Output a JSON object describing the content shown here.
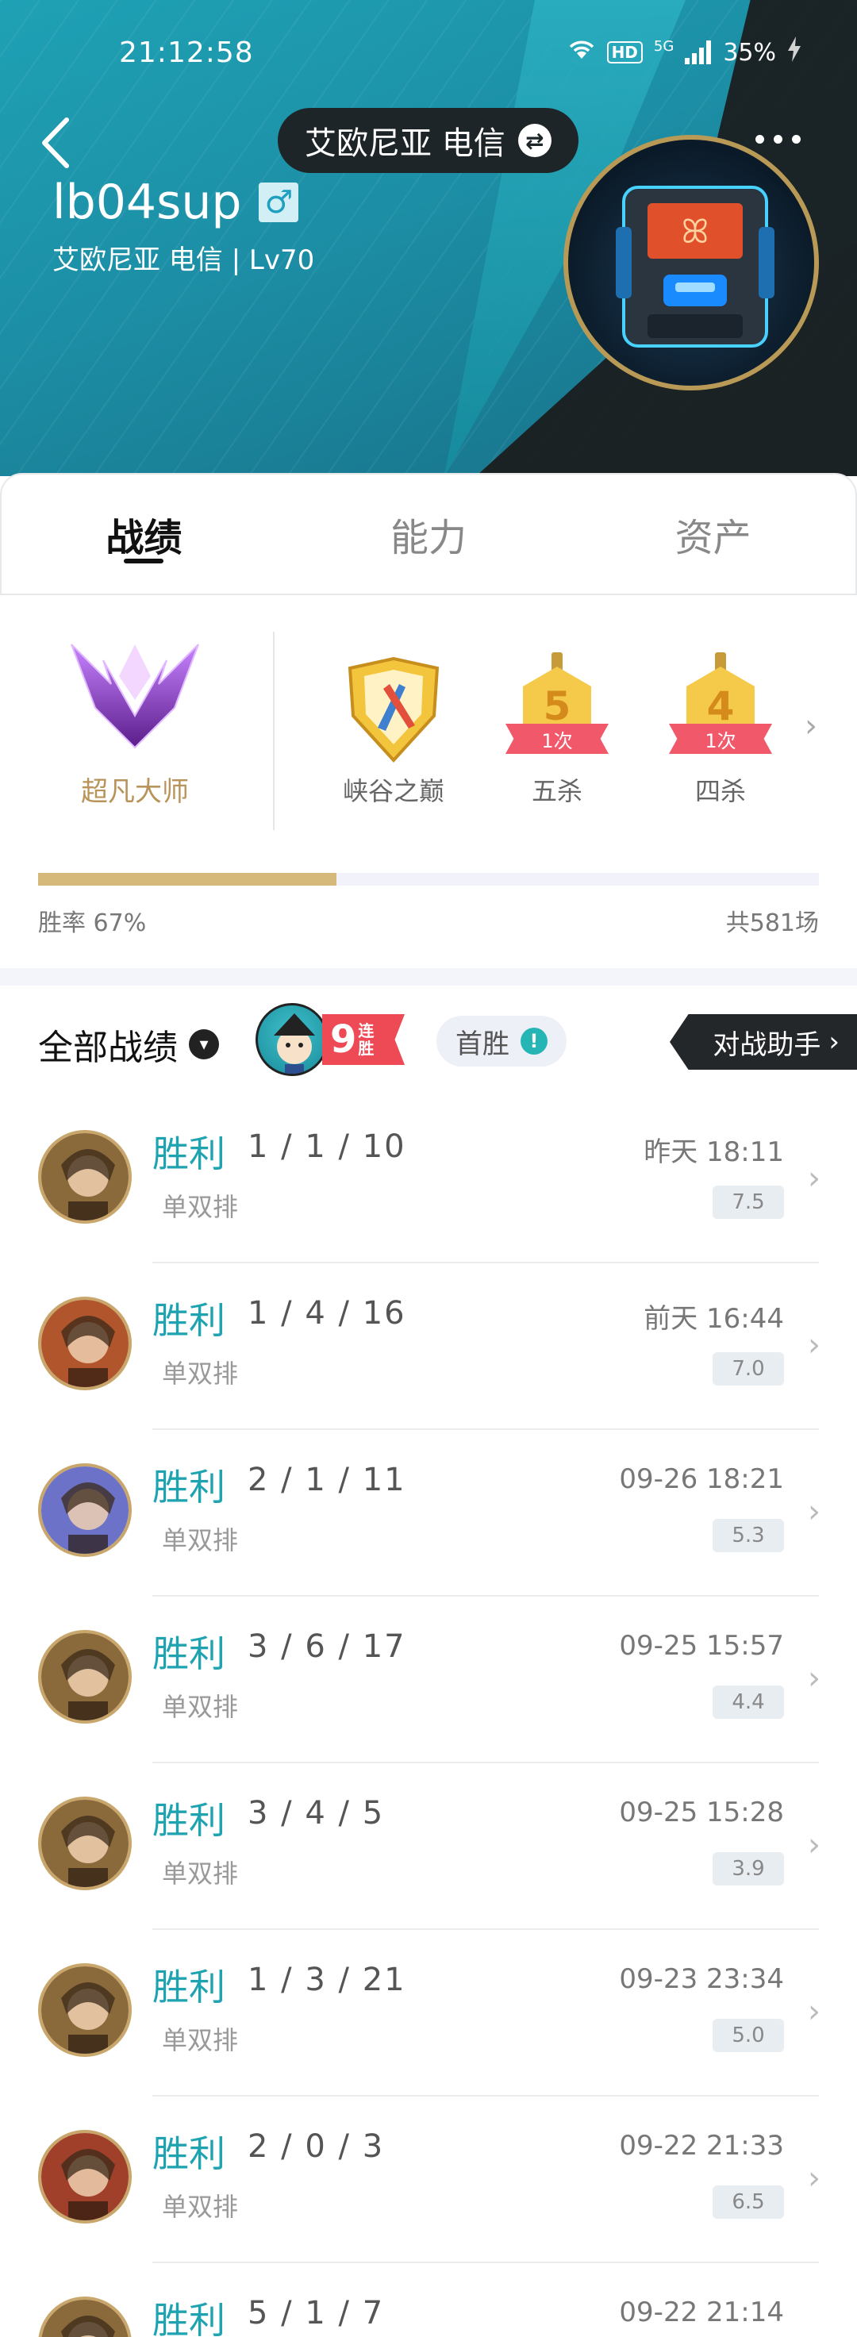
{
  "status_bar": {
    "time": "21:12:58",
    "hd": "HD",
    "network": "5G",
    "battery": "35%"
  },
  "header": {
    "server_pill": "艾欧尼亚 电信",
    "username": "lb04sup",
    "gender_symbol": "♂",
    "subtitle": "艾欧尼亚 电信 | Lv70"
  },
  "tabs": [
    {
      "label": "战绩",
      "active": true
    },
    {
      "label": "能力",
      "active": false
    },
    {
      "label": "资产",
      "active": false
    }
  ],
  "rank": {
    "name": "超凡大师"
  },
  "honors": [
    {
      "label": "峡谷之巅"
    },
    {
      "label": "五杀",
      "number": "5",
      "count": "1次"
    },
    {
      "label": "四杀",
      "number": "4",
      "count": "1次"
    }
  ],
  "stats": {
    "win_rate_label": "胜率 67%",
    "win_rate": 0.67,
    "total": "共581场"
  },
  "records": {
    "filter_label": "全部战绩",
    "streak_number": "9",
    "streak_text": "连胜",
    "first_win": "首胜",
    "assistant": "对战助手"
  },
  "matches": [
    {
      "result": "胜利",
      "kda": "1 / 1 / 10",
      "mode": "单双排",
      "time": "昨天 18:11",
      "score": "7.5",
      "hero_color": "#8a6a3a"
    },
    {
      "result": "胜利",
      "kda": "1 / 4 / 16",
      "mode": "单双排",
      "time": "前天 16:44",
      "score": "7.0",
      "hero_color": "#b0552c"
    },
    {
      "result": "胜利",
      "kda": "2 / 1 / 11",
      "mode": "单双排",
      "time": "09-26 18:21",
      "score": "5.3",
      "hero_color": "#6b72c8"
    },
    {
      "result": "胜利",
      "kda": "3 / 6 / 17",
      "mode": "单双排",
      "time": "09-25 15:57",
      "score": "4.4",
      "hero_color": "#8a6a3a"
    },
    {
      "result": "胜利",
      "kda": "3 / 4 / 5",
      "mode": "单双排",
      "time": "09-25 15:28",
      "score": "3.9",
      "hero_color": "#8a6a3a"
    },
    {
      "result": "胜利",
      "kda": "1 / 3 / 21",
      "mode": "单双排",
      "time": "09-23 23:34",
      "score": "5.0",
      "hero_color": "#8a6a3a"
    },
    {
      "result": "胜利",
      "kda": "2 / 0 / 3",
      "mode": "单双排",
      "time": "09-22 21:33",
      "score": "6.5",
      "hero_color": "#a0402a"
    },
    {
      "result": "胜利",
      "kda": "5 / 1 / 7",
      "mode": "",
      "time": "09-22 21:14",
      "score": "",
      "hero_color": "#8a6a3a"
    }
  ]
}
